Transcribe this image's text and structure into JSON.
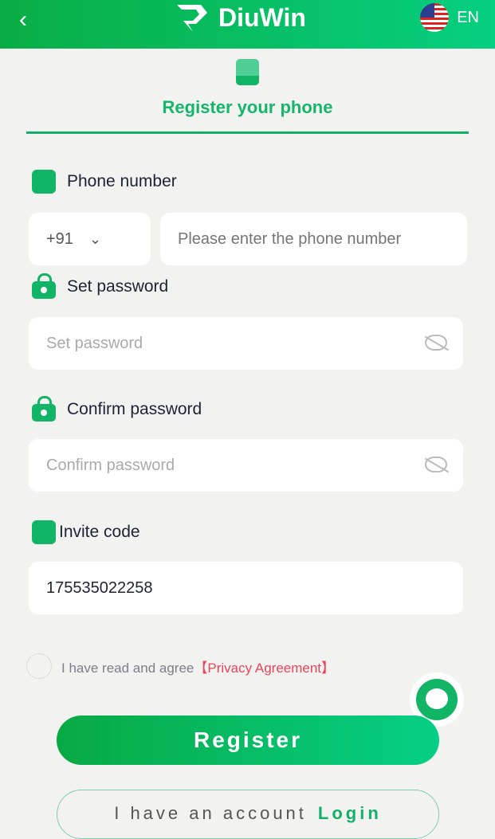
{
  "header": {
    "back": "‹",
    "brand": "DiuWin",
    "lang": "EN"
  },
  "tab": {
    "title": "Register your phone"
  },
  "phone": {
    "label": "Phone number",
    "code": "+91",
    "placeholder": "Please enter the phone number"
  },
  "password": {
    "label": "Set password",
    "placeholder": "Set password"
  },
  "confirm": {
    "label": "Confirm password",
    "placeholder": "Confirm password"
  },
  "invite": {
    "label": "Invite code",
    "value": "175535022258"
  },
  "agree": {
    "text": "I have read and agree",
    "link": "【Privacy Agreement】"
  },
  "register": "Register",
  "login": {
    "text": "I have an account",
    "link": "Login"
  },
  "colors": {
    "accent": "#12b565",
    "link": "#e9455a"
  }
}
